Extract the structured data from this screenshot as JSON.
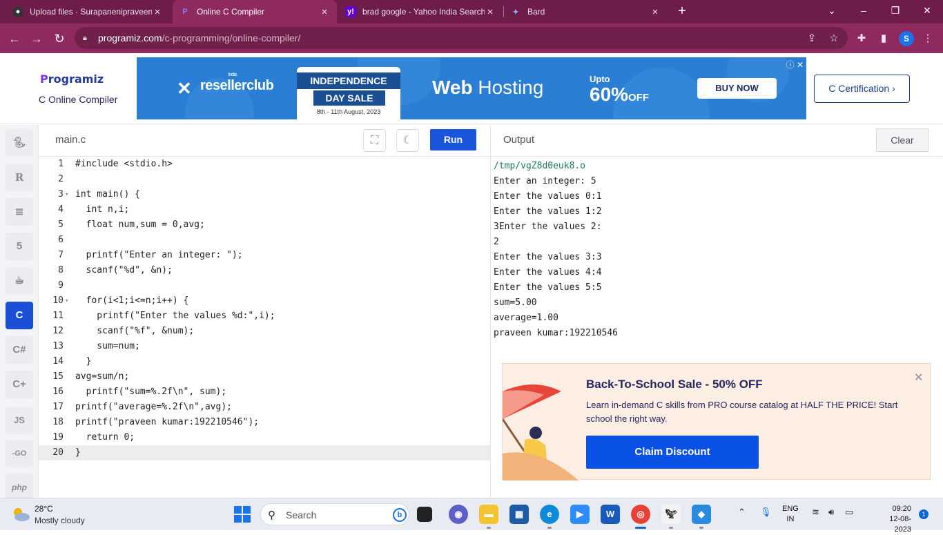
{
  "browser": {
    "tabs": [
      {
        "title": "Upload files · Surapanenipraveenk",
        "favicon": "github-icon",
        "active": false
      },
      {
        "title": "Online C Compiler",
        "favicon": "programiz-icon",
        "active": true
      },
      {
        "title": "brad google - Yahoo India Search",
        "favicon": "yahoo-icon",
        "active": false
      },
      {
        "title": "Bard",
        "favicon": "bard-icon",
        "active": false
      }
    ],
    "url_host": "programiz.com",
    "url_path": "/c-programming/online-compiler/",
    "profile_initial": "S"
  },
  "site": {
    "logo_text": "rogramiz",
    "logo_p": "P",
    "subtitle": "C Online Compiler",
    "certification_label": "C Certification ›"
  },
  "ad": {
    "brand": "resellerclub",
    "brand_small": "India",
    "badge_line1": "INDEPENDENCE",
    "badge_line2": "DAY SALE",
    "badge_dates": "8th - 11th August, 2023",
    "web": "Web",
    "hosting": "Hosting",
    "upto": "Upto",
    "pct": "60%",
    "off": "OFF",
    "buy": "BUY NOW"
  },
  "rail": {
    "languages": [
      "python",
      "r",
      "sql",
      "html",
      "java",
      "c",
      "csharp",
      "cpp",
      "js",
      "go",
      "php"
    ],
    "js_label": "JS",
    "go_label": "-GO",
    "php_label": "php"
  },
  "editor": {
    "filename": "main.c",
    "run_label": "Run",
    "lines": [
      "#include <stdio.h>",
      "",
      "int main() {",
      "  int n,i;",
      "  float num,sum = 0,avg;",
      "",
      "  printf(\"Enter an integer: \");",
      "  scanf(\"%d\", &n);",
      "",
      "  for(i<1;i<=n;i++) {",
      "    printf(\"Enter the values %d:\",i);",
      "    scanf(\"%f\", &num);",
      "    sum=num;",
      "  }",
      "avg=sum/n;",
      "  printf(\"sum=%.2f\\n\", sum);",
      "printf(\"average=%.2f\\n\",avg);",
      "printf(\"praveen kumar:192210546\");",
      "  return 0;",
      "}"
    ],
    "fold_lines": [
      3,
      10
    ],
    "current_line": 20
  },
  "output": {
    "title": "Output",
    "clear_label": "Clear",
    "lines": [
      "/tmp/vgZ8d0euk8.o",
      "Enter an integer: 5",
      "Enter the values 0:1",
      "Enter the values 1:2",
      "3Enter the values 2:",
      "2",
      "Enter the values 3:3",
      "Enter the values 4:4",
      "Enter the values 5:5",
      "sum=5.00",
      "average=1.00",
      "praveen kumar:192210546"
    ]
  },
  "promo": {
    "title": "Back-To-School Sale - 50% OFF",
    "text": "Learn in-demand C skills from PRO course catalog at HALF THE PRICE! Start school the right way.",
    "button": "Claim Discount"
  },
  "taskbar": {
    "temperature": "28°C",
    "condition": "Mostly cloudy",
    "search_placeholder": "Search",
    "lang_line1": "ENG",
    "lang_line2": "IN",
    "time": "09:20",
    "date": "12-08-2023",
    "notifications": "1",
    "apps": [
      "file-explorer-app",
      "microsoft-store-app",
      "edge-browser-app",
      "zoom-app",
      "word-app",
      "chrome-app",
      "game-app",
      "photos-app"
    ]
  },
  "colors": {
    "browser_frame": "#6e1c4a",
    "browser_toolbar": "#8f2a5f",
    "run_button": "#1a56db",
    "claim_button": "#0a51e6",
    "promo_bg": "#fdeee3"
  }
}
